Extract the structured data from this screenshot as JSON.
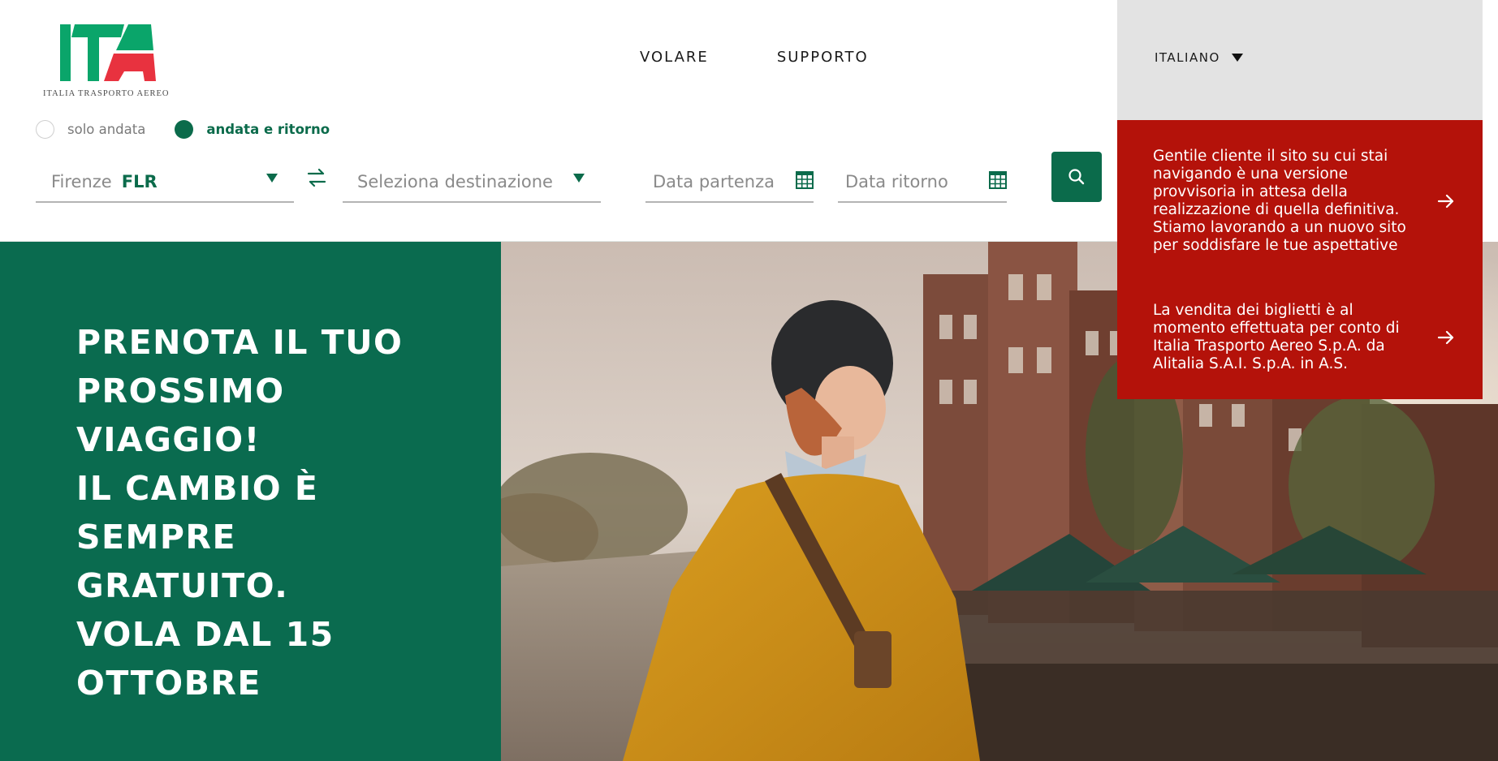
{
  "brand": {
    "logo_text": "ITA",
    "logo_subtitle": "ITALIA TRASPORTO AEREO",
    "colors": {
      "green": "#0b6b4b",
      "logo_green": "#0aa56a",
      "logo_red": "#e8323f",
      "notice_red": "#b4120a",
      "language_bg": "#e3e3e3"
    }
  },
  "nav": {
    "items": [
      {
        "label": "VOLARE"
      },
      {
        "label": "SUPPORTO"
      }
    ]
  },
  "language": {
    "selected": "ITALIANO",
    "icon": "chevron-down-icon"
  },
  "trip_type": {
    "options": [
      {
        "label": "solo andata",
        "checked": false
      },
      {
        "label": "andata e ritorno",
        "checked": true
      }
    ]
  },
  "search": {
    "origin_city": "Firenze",
    "origin_code": "FLR",
    "destination_placeholder": "Seleziona destinazione",
    "departure_placeholder": "Data partenza",
    "return_placeholder": "Data ritorno",
    "swap_icon": "swap-arrows-icon",
    "calendar_icon": "calendar-icon",
    "search_icon": "search-icon"
  },
  "hero": {
    "title_lines": [
      "PRENOTA IL TUO\nPROSSIMO\nVIAGGIO!",
      "IL CAMBIO È\nSEMPRE\nGRATUITO.",
      "VOLA DAL 15\nOTTOBRE"
    ]
  },
  "notices": [
    {
      "text": "Gentile cliente il sito su cui stai navigando è una versione provvisoria in attesa della realizzazione di quella definitiva. Stiamo lavorando a un nuovo sito per soddisfare le tue aspettative",
      "icon": "arrow-right-icon"
    },
    {
      "text": "La vendita dei biglietti è al momento effettuata per conto di Italia Trasporto Aereo S.p.A. da Alitalia S.A.I. S.p.A. in A.S.",
      "icon": "arrow-right-icon"
    }
  ]
}
